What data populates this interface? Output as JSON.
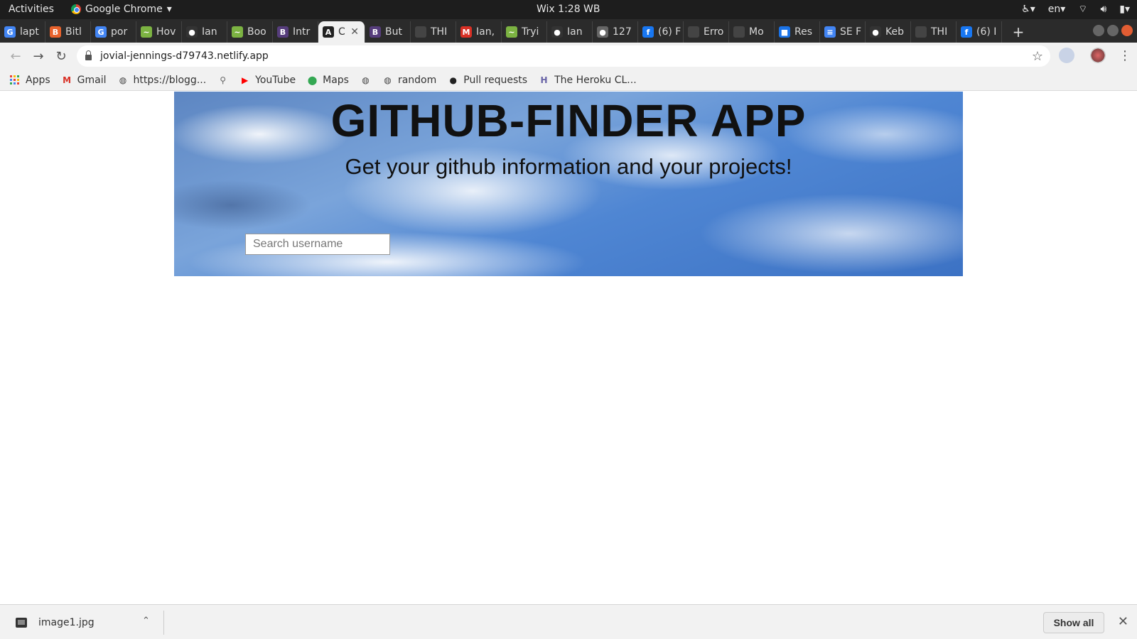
{
  "system_bar": {
    "activities": "Activities",
    "app_name": "Google Chrome",
    "clock": "Wix  1:28 WB",
    "lang": "en"
  },
  "tabs": [
    {
      "label": "lapt",
      "color": "#4285f4",
      "icon": "G"
    },
    {
      "label": "Bitl",
      "color": "#e8622c",
      "icon": "B"
    },
    {
      "label": "por",
      "color": "#4285f4",
      "icon": "G"
    },
    {
      "label": "Hov",
      "color": "#7cb342",
      "icon": "~"
    },
    {
      "label": "Ian",
      "color": "#333333",
      "icon": "●"
    },
    {
      "label": "Boo",
      "color": "#7cb342",
      "icon": "~"
    },
    {
      "label": "Intr",
      "color": "#563d7c",
      "icon": "B"
    },
    {
      "label": "C",
      "color": "#222222",
      "icon": "A",
      "active": true
    },
    {
      "label": "But",
      "color": "#563d7c",
      "icon": "B"
    },
    {
      "label": "THI",
      "color": "#444444",
      "icon": ""
    },
    {
      "label": "Ian,",
      "color": "#d93025",
      "icon": "M"
    },
    {
      "label": "Tryi",
      "color": "#7cb342",
      "icon": "~"
    },
    {
      "label": "Ian",
      "color": "#333333",
      "icon": "●"
    },
    {
      "label": "127",
      "color": "#666666",
      "icon": "●"
    },
    {
      "label": "(6) F",
      "color": "#1877f2",
      "icon": "f"
    },
    {
      "label": "Erro",
      "color": "#444444",
      "icon": ""
    },
    {
      "label": "Mo",
      "color": "#444444",
      "icon": ""
    },
    {
      "label": "Res",
      "color": "#1a73e8",
      "icon": "■"
    },
    {
      "label": "SE F",
      "color": "#4285f4",
      "icon": "≡"
    },
    {
      "label": "Keb",
      "color": "#333333",
      "icon": "●"
    },
    {
      "label": "THI",
      "color": "#444444",
      "icon": ""
    },
    {
      "label": "(6) I",
      "color": "#1877f2",
      "icon": "f"
    }
  ],
  "address_bar": {
    "url": "jovial-jennings-d79743.netlify.app"
  },
  "bookmarks": [
    {
      "label": "Apps",
      "icon": "apps-grid-icon"
    },
    {
      "label": "Gmail",
      "icon": "gmail-icon"
    },
    {
      "label": "https://blogg...",
      "icon": "globe-icon"
    },
    {
      "label": "",
      "icon": "pin-icon"
    },
    {
      "label": "YouTube",
      "icon": "youtube-icon"
    },
    {
      "label": "Maps",
      "icon": "maps-icon"
    },
    {
      "label": "",
      "icon": "globe-icon"
    },
    {
      "label": "random",
      "icon": "globe-icon"
    },
    {
      "label": "Pull requests",
      "icon": "github-icon"
    },
    {
      "label": "The Heroku CL...",
      "icon": "heroku-icon"
    }
  ],
  "hero": {
    "title": "GITHUB-FINDER APP",
    "subtitle": "Get your github information and your projects!",
    "search_placeholder": "Search username"
  },
  "download_bar": {
    "filename": "image1.jpg",
    "show_all": "Show all"
  },
  "colors": {
    "accent_blue": "#4f86d3",
    "chrome_frame": "#2b2b2b",
    "toolbar": "#f1f1f1"
  }
}
